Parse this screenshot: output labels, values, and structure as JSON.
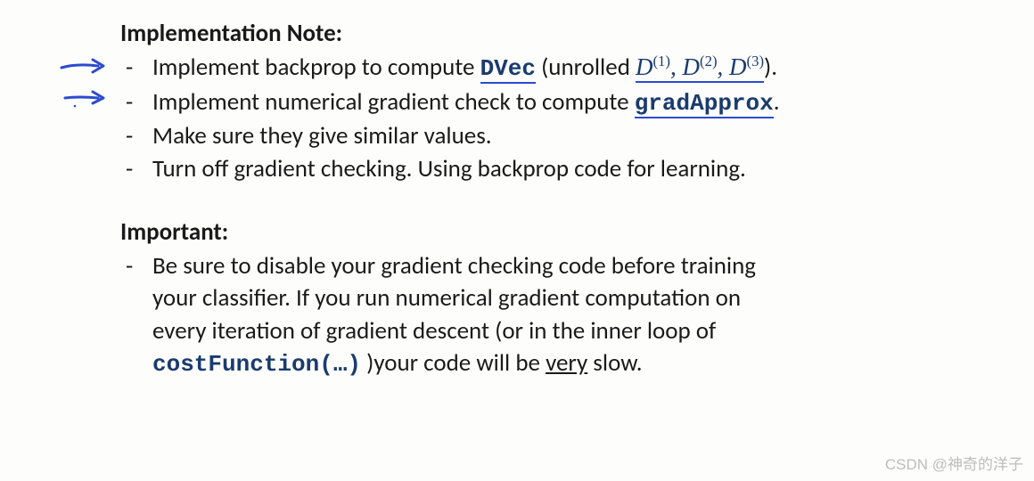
{
  "section1": {
    "heading": "Implementation Note:",
    "items": [
      {
        "pre": "Implement backprop to compute ",
        "code": "DVec",
        "mid": " (unrolled  ",
        "d1": "D",
        "s1": "(1)",
        "c1": ", ",
        "d2": "D",
        "s2": "(2)",
        "c2": ", ",
        "d3": "D",
        "s3": "(3)",
        "post": ")."
      },
      {
        "pre": "Implement numerical gradient check to compute ",
        "code": "gradApprox",
        "post": "."
      },
      {
        "text": "Make sure they give similar values."
      },
      {
        "text": "Turn off gradient checking. Using backprop code for learning."
      }
    ]
  },
  "section2": {
    "heading": "Important:",
    "item": {
      "line1": "Be sure to disable your gradient checking code before training",
      "line2": "your classifier. If you run numerical gradient computation on",
      "line3": "every iteration of gradient descent (or in the inner loop of",
      "code": "costFunction(…)",
      "line4a": " )your code will be ",
      "very": "very",
      "line4b": " slow."
    }
  },
  "watermark": "CSDN @神奇的洋子",
  "dash": "-"
}
